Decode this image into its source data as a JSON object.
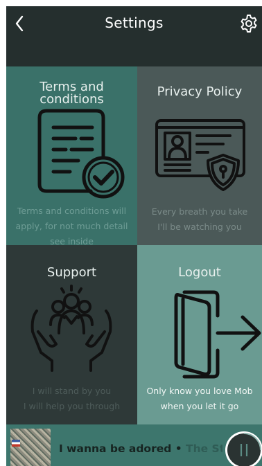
{
  "header": {
    "title": "Settings",
    "back_icon": "chevron-left-icon",
    "settings_icon": "gear-icon"
  },
  "tiles": {
    "terms": {
      "title_line1": "Terms and",
      "title_line2": "conditions",
      "desc_line1": "Terms and conditions will",
      "desc_line2": "apply, for not much detail",
      "desc_line3": "see inside",
      "icon": "document-check-icon",
      "color": "#3a7169"
    },
    "privacy": {
      "title": "Privacy Policy",
      "desc_line1": "Every breath you take",
      "desc_line2": "I'll be watching you",
      "icon": "id-card-shield-icon",
      "color": "#4b5958"
    },
    "support": {
      "title": "Support",
      "desc_line1": "I will stand by you",
      "desc_line2": "I will help you through",
      "icon": "hands-people-icon",
      "color": "#2e3938"
    },
    "logout": {
      "title": "Logout",
      "desc_line1": "Only know you love Mob",
      "desc_line2": "when you let it go",
      "icon": "exit-door-icon",
      "color": "#6a9b92"
    }
  },
  "player": {
    "track_title": "I wanna be adored",
    "separator": " • ",
    "artist": "The Stone Roses",
    "pause_icon": "pause-icon",
    "album_art": "album-cover"
  }
}
